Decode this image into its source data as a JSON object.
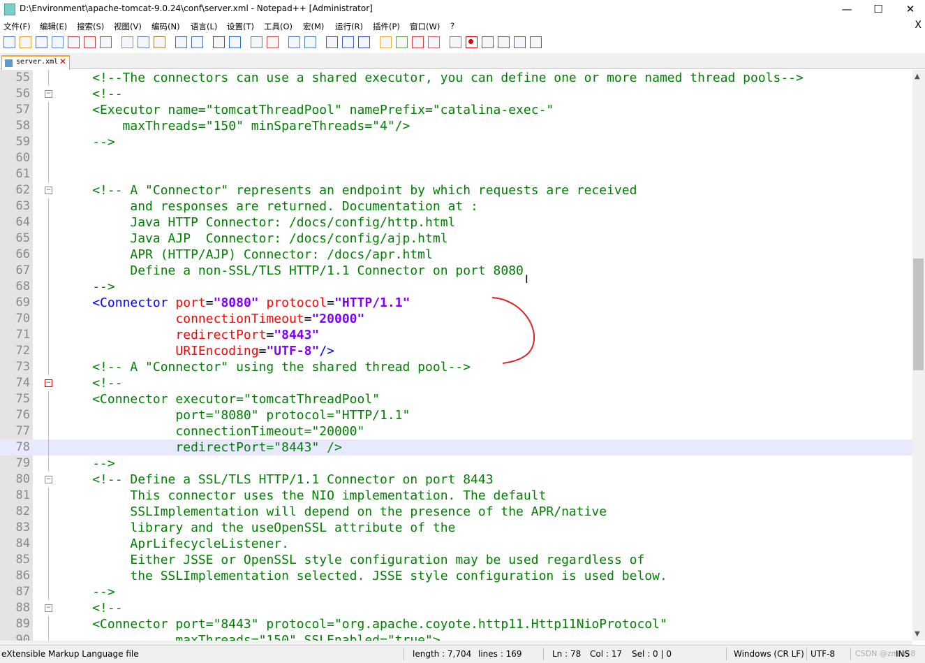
{
  "window": {
    "title": "D:\\Environment\\apache-tomcat-9.0.24\\conf\\server.xml - Notepad++ [Administrator]",
    "minimize": "—",
    "maximize": "☐",
    "close": "✕"
  },
  "menu": {
    "items": [
      "文件(F)",
      "编辑(E)",
      "搜索(S)",
      "视图(V)",
      "编码(N)",
      "语言(L)",
      "设置(T)",
      "工具(O)",
      "宏(M)",
      "运行(R)",
      "插件(P)",
      "窗口(W)",
      "?"
    ],
    "close_doc": "X"
  },
  "toolbar": {
    "icons": [
      "new-file-icon",
      "open-file-icon",
      "save-icon",
      "save-all-icon",
      "close-icon",
      "close-all-icon",
      "print-icon",
      "cut-icon",
      "copy-icon",
      "paste-icon",
      "undo-icon",
      "redo-icon",
      "find-icon",
      "replace-icon",
      "zoom-in-icon",
      "zoom-out-icon",
      "sync-v-icon",
      "sync-h-icon",
      "wrap-icon",
      "all-chars-icon",
      "indent-guide-icon",
      "udl-icon",
      "doc-map-icon",
      "function-list-icon",
      "folder-workspace-icon",
      "monitor-icon",
      "record-macro-icon",
      "stop-macro-icon",
      "play-macro-icon",
      "run-macro-multiple-icon",
      "save-macro-icon"
    ]
  },
  "tabs": [
    {
      "label": "server.xml",
      "active": true
    }
  ],
  "editor": {
    "current_line": 78,
    "lines": [
      {
        "n": "55",
        "fold": "",
        "code": [
          [
            "     ",
            ""
          ],
          [
            "<!--The connectors can use a shared executor, you can define one or more named thread pools-->",
            "c"
          ]
        ]
      },
      {
        "n": "56",
        "fold": "minus",
        "code": [
          [
            "     ",
            ""
          ],
          [
            "<!--",
            "c"
          ]
        ]
      },
      {
        "n": "57",
        "fold": "",
        "code": [
          [
            "     ",
            ""
          ],
          [
            "<Executor name=\"tomcatThreadPool\" namePrefix=\"catalina-exec-\"",
            "c"
          ]
        ]
      },
      {
        "n": "58",
        "fold": "",
        "code": [
          [
            "         ",
            ""
          ],
          [
            "maxThreads=\"150\" minSpareThreads=\"4\"/>",
            "c"
          ]
        ]
      },
      {
        "n": "59",
        "fold": "",
        "code": [
          [
            "     ",
            ""
          ],
          [
            "-->",
            "c"
          ]
        ]
      },
      {
        "n": "60",
        "fold": "",
        "code": []
      },
      {
        "n": "61",
        "fold": "",
        "code": []
      },
      {
        "n": "62",
        "fold": "minus",
        "code": [
          [
            "     ",
            ""
          ],
          [
            "<!-- A \"Connector\" represents an endpoint by which requests are received",
            "c"
          ]
        ]
      },
      {
        "n": "63",
        "fold": "",
        "code": [
          [
            "          ",
            ""
          ],
          [
            "and responses are returned. Documentation at :",
            "c"
          ]
        ]
      },
      {
        "n": "64",
        "fold": "",
        "code": [
          [
            "          ",
            ""
          ],
          [
            "Java HTTP Connector: /docs/config/http.html",
            "c"
          ]
        ]
      },
      {
        "n": "65",
        "fold": "",
        "code": [
          [
            "          ",
            ""
          ],
          [
            "Java AJP  Connector: /docs/config/ajp.html",
            "c"
          ]
        ]
      },
      {
        "n": "66",
        "fold": "",
        "code": [
          [
            "          ",
            ""
          ],
          [
            "APR (HTTP/AJP) Connector: /docs/apr.html",
            "c"
          ]
        ]
      },
      {
        "n": "67",
        "fold": "",
        "code": [
          [
            "          ",
            ""
          ],
          [
            "Define a non-SSL/TLS HTTP/1.1 Connector on port 8080",
            "c"
          ]
        ]
      },
      {
        "n": "68",
        "fold": "",
        "code": [
          [
            "     ",
            ""
          ],
          [
            "-->",
            "c"
          ]
        ]
      },
      {
        "n": "69",
        "fold": "",
        "code": [
          [
            "     ",
            ""
          ],
          [
            "<Connector",
            "tag"
          ],
          [
            " ",
            ""
          ],
          [
            "port",
            "attr"
          ],
          [
            "=",
            ""
          ],
          [
            "\"8080\"",
            "val"
          ],
          [
            " ",
            ""
          ],
          [
            "protocol",
            "attr"
          ],
          [
            "=",
            ""
          ],
          [
            "\"HTTP/1.1\"",
            "val"
          ]
        ]
      },
      {
        "n": "70",
        "fold": "",
        "code": [
          [
            "                ",
            ""
          ],
          [
            "connectionTimeout",
            "attr"
          ],
          [
            "=",
            ""
          ],
          [
            "\"20000\"",
            "val"
          ]
        ]
      },
      {
        "n": "71",
        "fold": "",
        "code": [
          [
            "                ",
            ""
          ],
          [
            "redirectPort",
            "attr"
          ],
          [
            "=",
            ""
          ],
          [
            "\"8443\"",
            "val"
          ]
        ]
      },
      {
        "n": "72",
        "fold": "",
        "code": [
          [
            "                ",
            ""
          ],
          [
            "URIEncoding",
            "attr"
          ],
          [
            "=",
            ""
          ],
          [
            "\"UTF-8\"",
            "val"
          ],
          [
            "/>",
            "tag"
          ]
        ]
      },
      {
        "n": "73",
        "fold": "",
        "code": [
          [
            "     ",
            ""
          ],
          [
            "<!-- A \"Connector\" using the shared thread pool-->",
            "c"
          ]
        ]
      },
      {
        "n": "74",
        "fold": "minus-red",
        "code": [
          [
            "     ",
            ""
          ],
          [
            "<!--",
            "c"
          ]
        ]
      },
      {
        "n": "75",
        "fold": "",
        "code": [
          [
            "     ",
            ""
          ],
          [
            "<Connector executor=\"tomcatThreadPool\"",
            "c"
          ]
        ]
      },
      {
        "n": "76",
        "fold": "",
        "code": [
          [
            "                ",
            ""
          ],
          [
            "port=\"8080\" protocol=\"HTTP/1.1\"",
            "c"
          ]
        ]
      },
      {
        "n": "77",
        "fold": "",
        "code": [
          [
            "                ",
            ""
          ],
          [
            "connectionTimeout=\"20000\"",
            "c"
          ]
        ]
      },
      {
        "n": "78",
        "fold": "",
        "code": [
          [
            "                ",
            ""
          ],
          [
            "redirectPort=\"8443\" />",
            "c"
          ]
        ]
      },
      {
        "n": "79",
        "fold": "",
        "code": [
          [
            "     ",
            ""
          ],
          [
            "-->",
            "c"
          ]
        ]
      },
      {
        "n": "80",
        "fold": "minus",
        "code": [
          [
            "     ",
            ""
          ],
          [
            "<!-- Define a SSL/TLS HTTP/1.1 Connector on port 8443",
            "c"
          ]
        ]
      },
      {
        "n": "81",
        "fold": "",
        "code": [
          [
            "          ",
            ""
          ],
          [
            "This connector uses the NIO implementation. The default",
            "c"
          ]
        ]
      },
      {
        "n": "82",
        "fold": "",
        "code": [
          [
            "          ",
            ""
          ],
          [
            "SSLImplementation will depend on the presence of the APR/native",
            "c"
          ]
        ]
      },
      {
        "n": "83",
        "fold": "",
        "code": [
          [
            "          ",
            ""
          ],
          [
            "library and the useOpenSSL attribute of the",
            "c"
          ]
        ]
      },
      {
        "n": "84",
        "fold": "",
        "code": [
          [
            "          ",
            ""
          ],
          [
            "AprLifecycleListener.",
            "c"
          ]
        ]
      },
      {
        "n": "85",
        "fold": "",
        "code": [
          [
            "          ",
            ""
          ],
          [
            "Either JSSE or OpenSSL style configuration may be used regardless of",
            "c"
          ]
        ]
      },
      {
        "n": "86",
        "fold": "",
        "code": [
          [
            "          ",
            ""
          ],
          [
            "the SSLImplementation selected. JSSE style configuration is used below.",
            "c"
          ]
        ]
      },
      {
        "n": "87",
        "fold": "",
        "code": [
          [
            "     ",
            ""
          ],
          [
            "-->",
            "c"
          ]
        ]
      },
      {
        "n": "88",
        "fold": "minus",
        "code": [
          [
            "     ",
            ""
          ],
          [
            "<!--",
            "c"
          ]
        ]
      },
      {
        "n": "89",
        "fold": "",
        "code": [
          [
            "     ",
            ""
          ],
          [
            "<Connector port=\"8443\" protocol=\"org.apache.coyote.http11.Http11NioProtocol\"",
            "c"
          ]
        ]
      },
      {
        "n": "90",
        "fold": "",
        "code": [
          [
            "                ",
            ""
          ],
          [
            "maxThreads=\"150\" SSLEnabled=\"true\">",
            "c"
          ]
        ]
      }
    ]
  },
  "statusbar": {
    "filetype": "eXtensible Markup Language file",
    "length": "length : 7,704",
    "lines": "lines : 169",
    "ln": "Ln : 78",
    "col": "Col : 17",
    "sel": "Sel : 0 | 0",
    "eol": "Windows (CR LF)",
    "encoding": "UTF-8",
    "mode": "INS",
    "watermark": "CSDN @zmlu58"
  },
  "colors": {
    "comment": "#008000",
    "tag": "#0000ff",
    "attribute": "#ff0000",
    "value": "#8000ff",
    "annotation": "#e02020",
    "tab_accent": "#f5a623"
  }
}
